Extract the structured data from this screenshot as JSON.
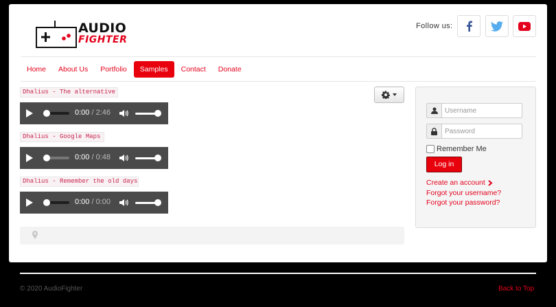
{
  "header": {
    "logo": {
      "line1": "AUDIO",
      "line2": "FIGHTER"
    },
    "follow_label": "Follow us:",
    "social": [
      {
        "icon": "facebook-icon",
        "color": "#3b5998"
      },
      {
        "icon": "twitter-icon",
        "color": "#55acee"
      },
      {
        "icon": "youtube-icon",
        "color": "#e4001b"
      }
    ]
  },
  "nav": {
    "items": [
      {
        "label": "Home",
        "active": false
      },
      {
        "label": "About Us",
        "active": false
      },
      {
        "label": "Portfolio",
        "active": false
      },
      {
        "label": "Samples",
        "active": true
      },
      {
        "label": "Contact",
        "active": false
      },
      {
        "label": "Donate",
        "active": false
      }
    ]
  },
  "tracks": [
    {
      "title": "Dhalius - The alternative",
      "current": "0:00",
      "separator": "/",
      "duration": "2:46"
    },
    {
      "title": "Dhalius - Google Maps",
      "current": "0:00",
      "separator": "/",
      "duration": "0:48"
    },
    {
      "title": "Dhalius - Remember the old days",
      "current": "0:00",
      "separator": "/",
      "duration": "0:00"
    }
  ],
  "login": {
    "username_placeholder": "Username",
    "password_placeholder": "Password",
    "remember_label": "Remember Me",
    "button_label": "Log in",
    "create_account": "Create an account",
    "forgot_username": "Forgot your username?",
    "forgot_password": "Forgot your password?"
  },
  "footer": {
    "copyright": "© 2020 AudioFighter",
    "back_to_top": "Back to Top"
  },
  "colors": {
    "accent": "#e4001b",
    "player_bg": "#4a4a4a",
    "background": "#000000"
  }
}
